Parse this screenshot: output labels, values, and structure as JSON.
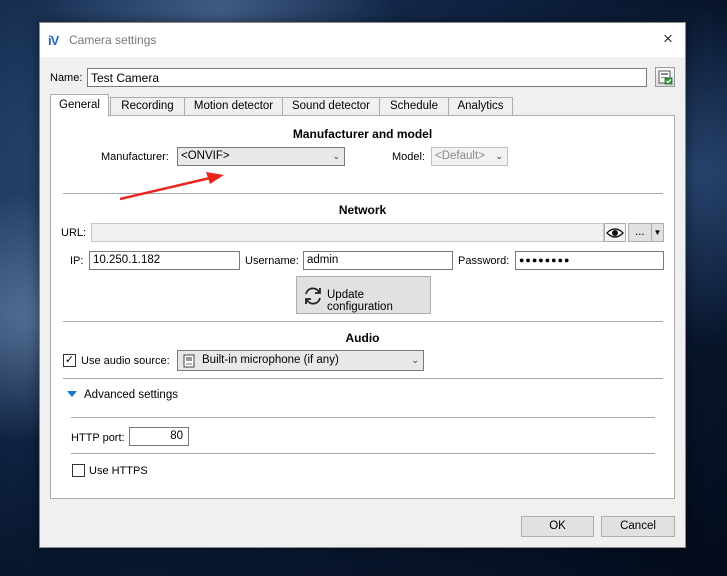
{
  "window": {
    "title": "Camera settings",
    "app_icon_text": "iV",
    "close_glyph": "×"
  },
  "name_field": {
    "label": "Name:",
    "value": "Test Camera"
  },
  "tabs": [
    {
      "label": "General",
      "active": true
    },
    {
      "label": "Recording",
      "active": false
    },
    {
      "label": "Motion detector",
      "active": false
    },
    {
      "label": "Sound detector",
      "active": false
    },
    {
      "label": "Schedule",
      "active": false
    },
    {
      "label": "Analytics",
      "active": false
    }
  ],
  "manufacturer_section": {
    "title": "Manufacturer and model",
    "manufacturer_label": "Manufacturer:",
    "manufacturer_value": "<ONVIF>",
    "model_label": "Model:",
    "model_value": "<Default>"
  },
  "network_section": {
    "title": "Network",
    "url_label": "URL:",
    "url_value": "",
    "more_button": "...",
    "ip_label": "IP:",
    "ip_value": "10.250.1.182",
    "username_label": "Username:",
    "username_value": "admin",
    "password_label": "Password:",
    "password_value": "●●●●●●●●",
    "update_button": "Update configuration"
  },
  "audio_section": {
    "title": "Audio",
    "use_audio_label": "Use audio source:",
    "use_audio_checked": true,
    "audio_source_value": "Built-in microphone (if any)"
  },
  "advanced": {
    "toggle_label": "Advanced settings",
    "http_port_label": "HTTP port:",
    "http_port_value": "80",
    "use_https_label": "Use HTTPS",
    "use_https_checked": false
  },
  "footer": {
    "ok_label": "OK",
    "cancel_label": "Cancel"
  },
  "colors": {
    "accent": "#1a78c9",
    "annotation_arrow": "#e8261e",
    "app_icon": "#2466c4"
  }
}
